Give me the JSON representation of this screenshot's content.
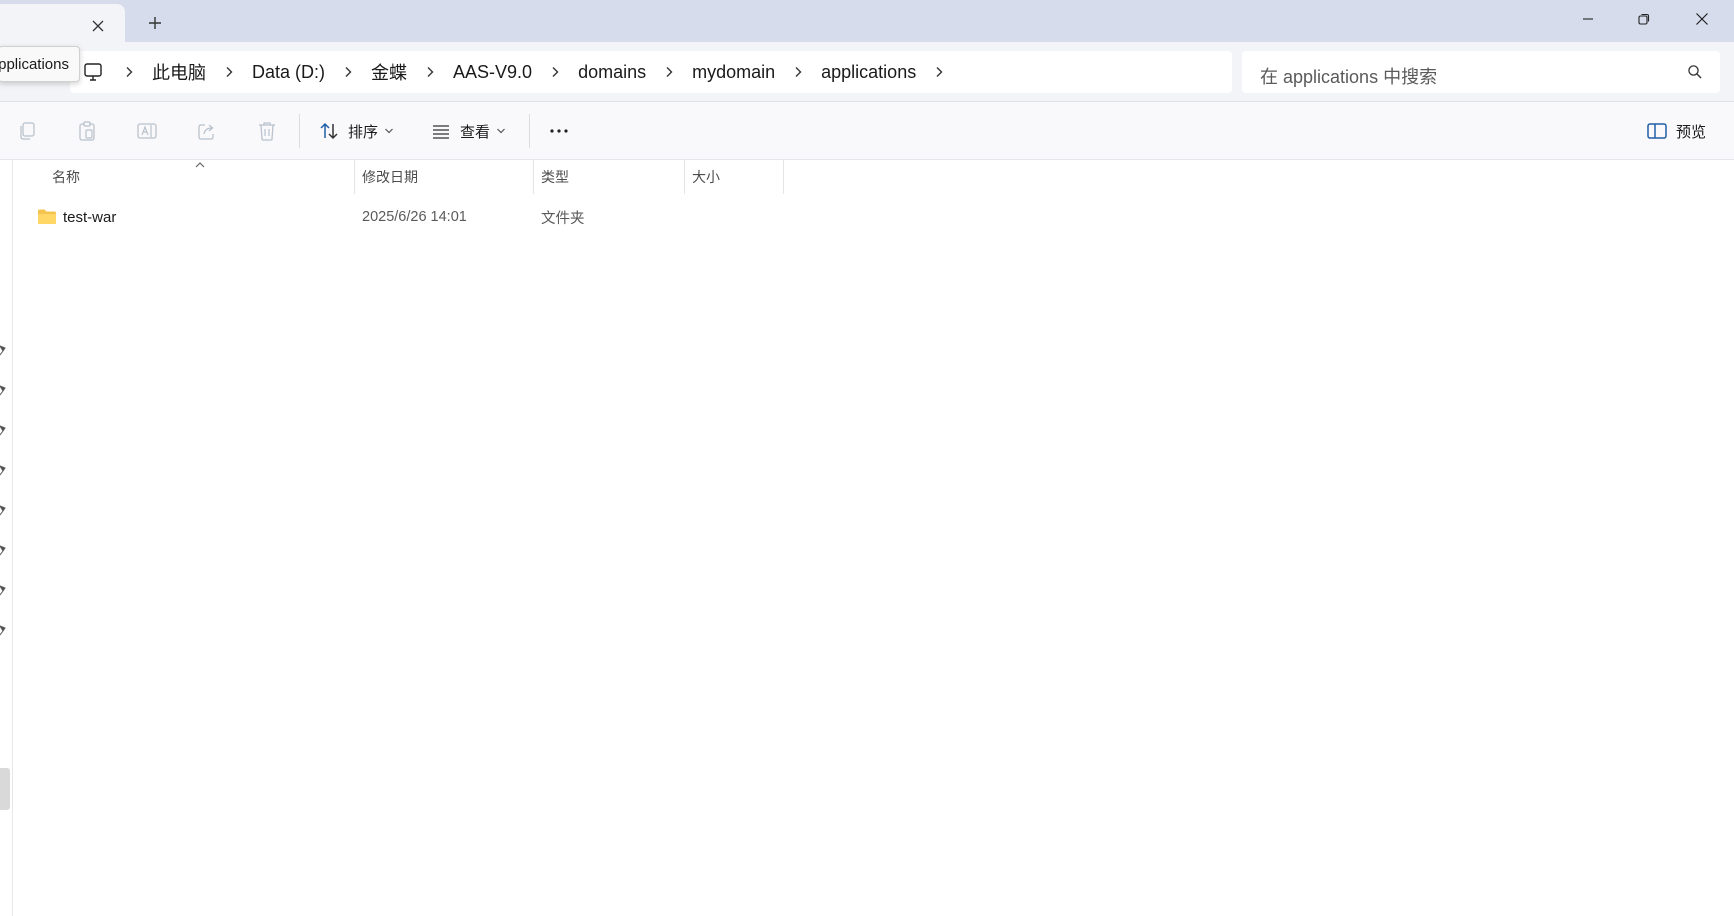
{
  "window": {
    "new_tab_icon": "plus-icon",
    "controls": [
      "minimize-icon",
      "restore-icon",
      "close-icon"
    ]
  },
  "tooltip": {
    "text": "pplications"
  },
  "address_bar": {
    "root_icon": "computer-icon",
    "crumbs": [
      "此电脑",
      "Data (D:)",
      "金蝶",
      "AAS-V9.0",
      "domains",
      "mydomain",
      "applications"
    ]
  },
  "search": {
    "placeholder": "在 applications 中搜索",
    "icon": "search-icon"
  },
  "commands": {
    "icons": [
      "copy-icon",
      "paste-icon",
      "rename-icon",
      "share-icon",
      "delete-icon"
    ],
    "sort_label": "排序",
    "view_label": "查看",
    "more_icon": "more-icon",
    "preview_label": "预览"
  },
  "columns": {
    "name": "名称",
    "modified": "修改日期",
    "type": "类型",
    "size": "大小"
  },
  "files": [
    {
      "name": "test-war",
      "modified": "2025/6/26 14:01",
      "type": "文件夹",
      "size": "",
      "icon": "folder-icon"
    }
  ]
}
